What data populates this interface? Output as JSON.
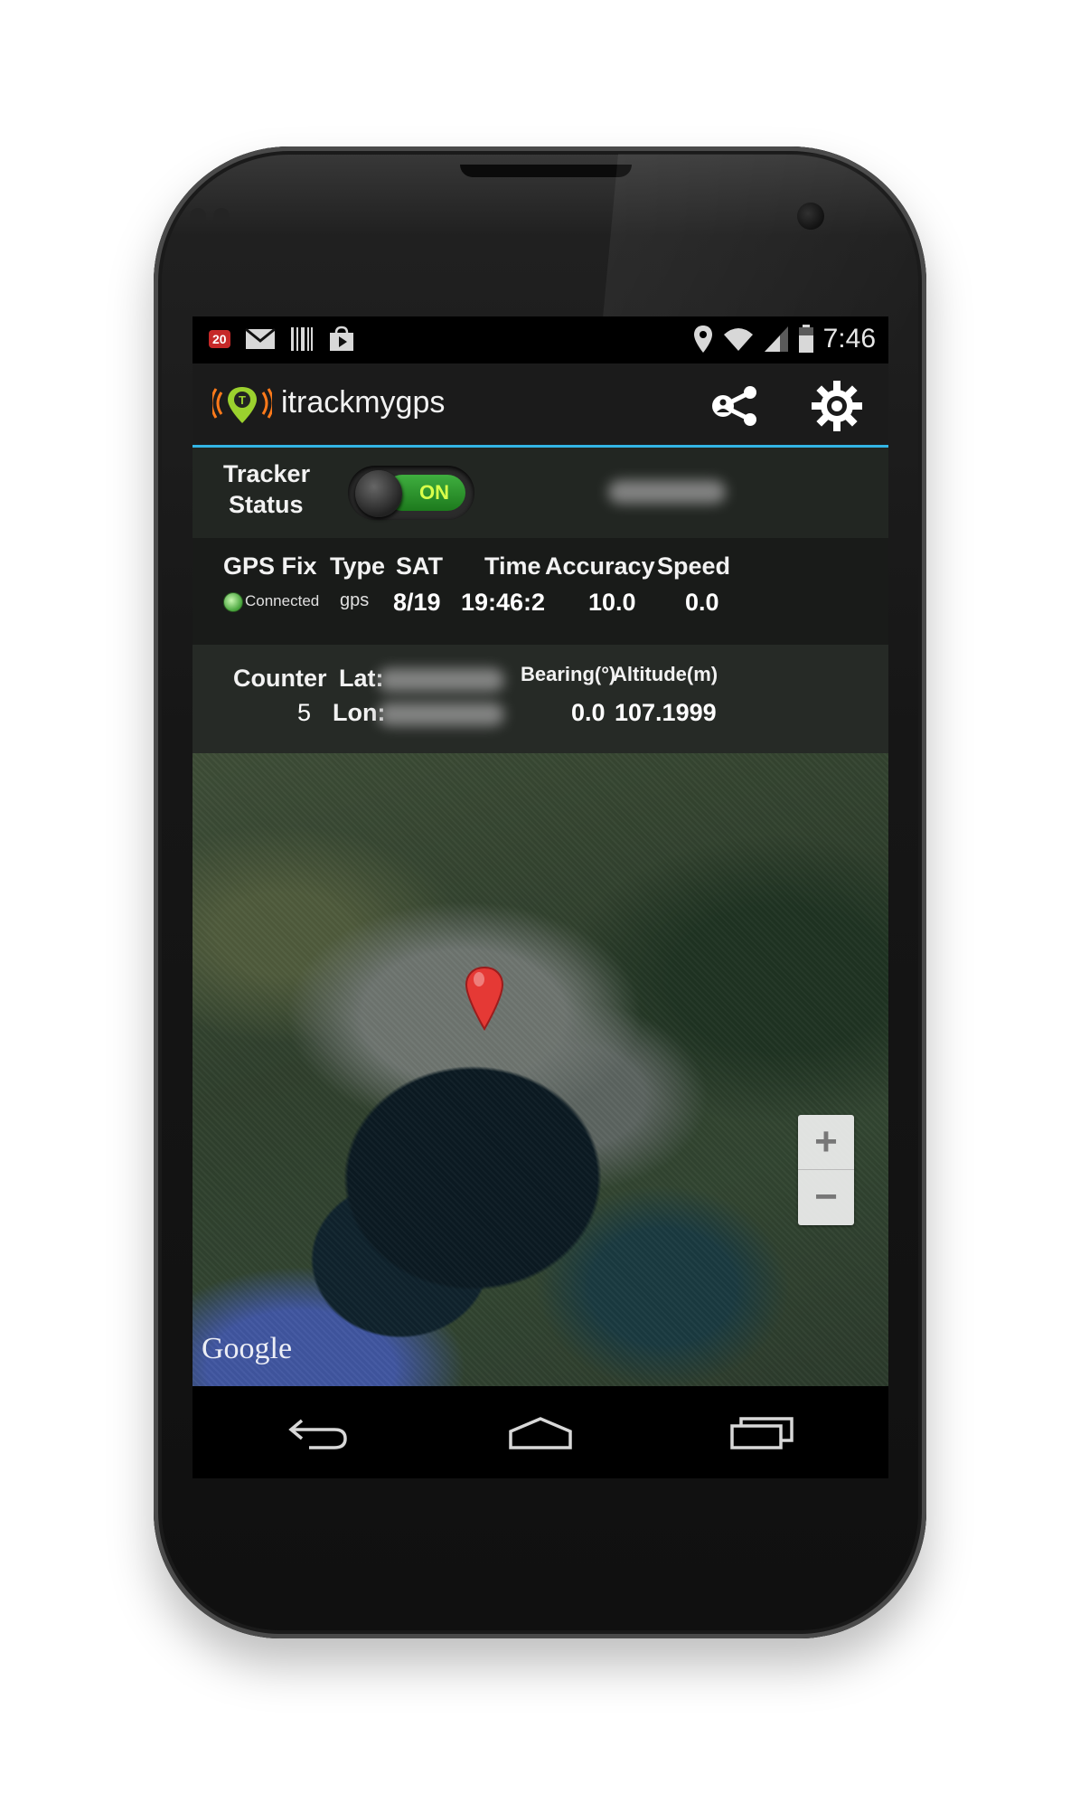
{
  "status_bar": {
    "notification_count": "20",
    "time": "7:46"
  },
  "app": {
    "title": "itrackmygps"
  },
  "tracker": {
    "label_line1": "Tracker",
    "label_line2": "Status",
    "toggle_state": "ON"
  },
  "gps": {
    "fix_label": "GPS Fix",
    "fix_status": "Connected",
    "type_label": "Type",
    "type_value": "gps",
    "sat_label": "SAT",
    "sat_value": "8/19",
    "time_label": "Time",
    "time_value": "19:46:2",
    "accuracy_label": "Accuracy",
    "accuracy_value": "10.0",
    "speed_label": "Speed",
    "speed_value": "0.0"
  },
  "position": {
    "counter_label": "Counter",
    "counter_value": "5",
    "lat_label": "Lat:",
    "lon_label": "Lon:",
    "bearing_label": "Bearing(°)",
    "bearing_value": "0.0",
    "altitude_label": "Altitude(m)",
    "altitude_value": "107.1999"
  },
  "map": {
    "attribution": "Google",
    "zoom_in": "+",
    "zoom_out": "−"
  },
  "colors": {
    "accent": "#33b5e5",
    "toggle_on": "#2e9a2e",
    "pin": "#e53935"
  },
  "icons": [
    "notification-badge-icon",
    "gmail-icon",
    "barcode-icon",
    "play-store-icon",
    "location-icon",
    "wifi-icon",
    "signal-icon",
    "battery-icon",
    "share-icon",
    "settings-icon",
    "back-icon",
    "home-icon",
    "recents-icon",
    "map-pin-icon"
  ]
}
